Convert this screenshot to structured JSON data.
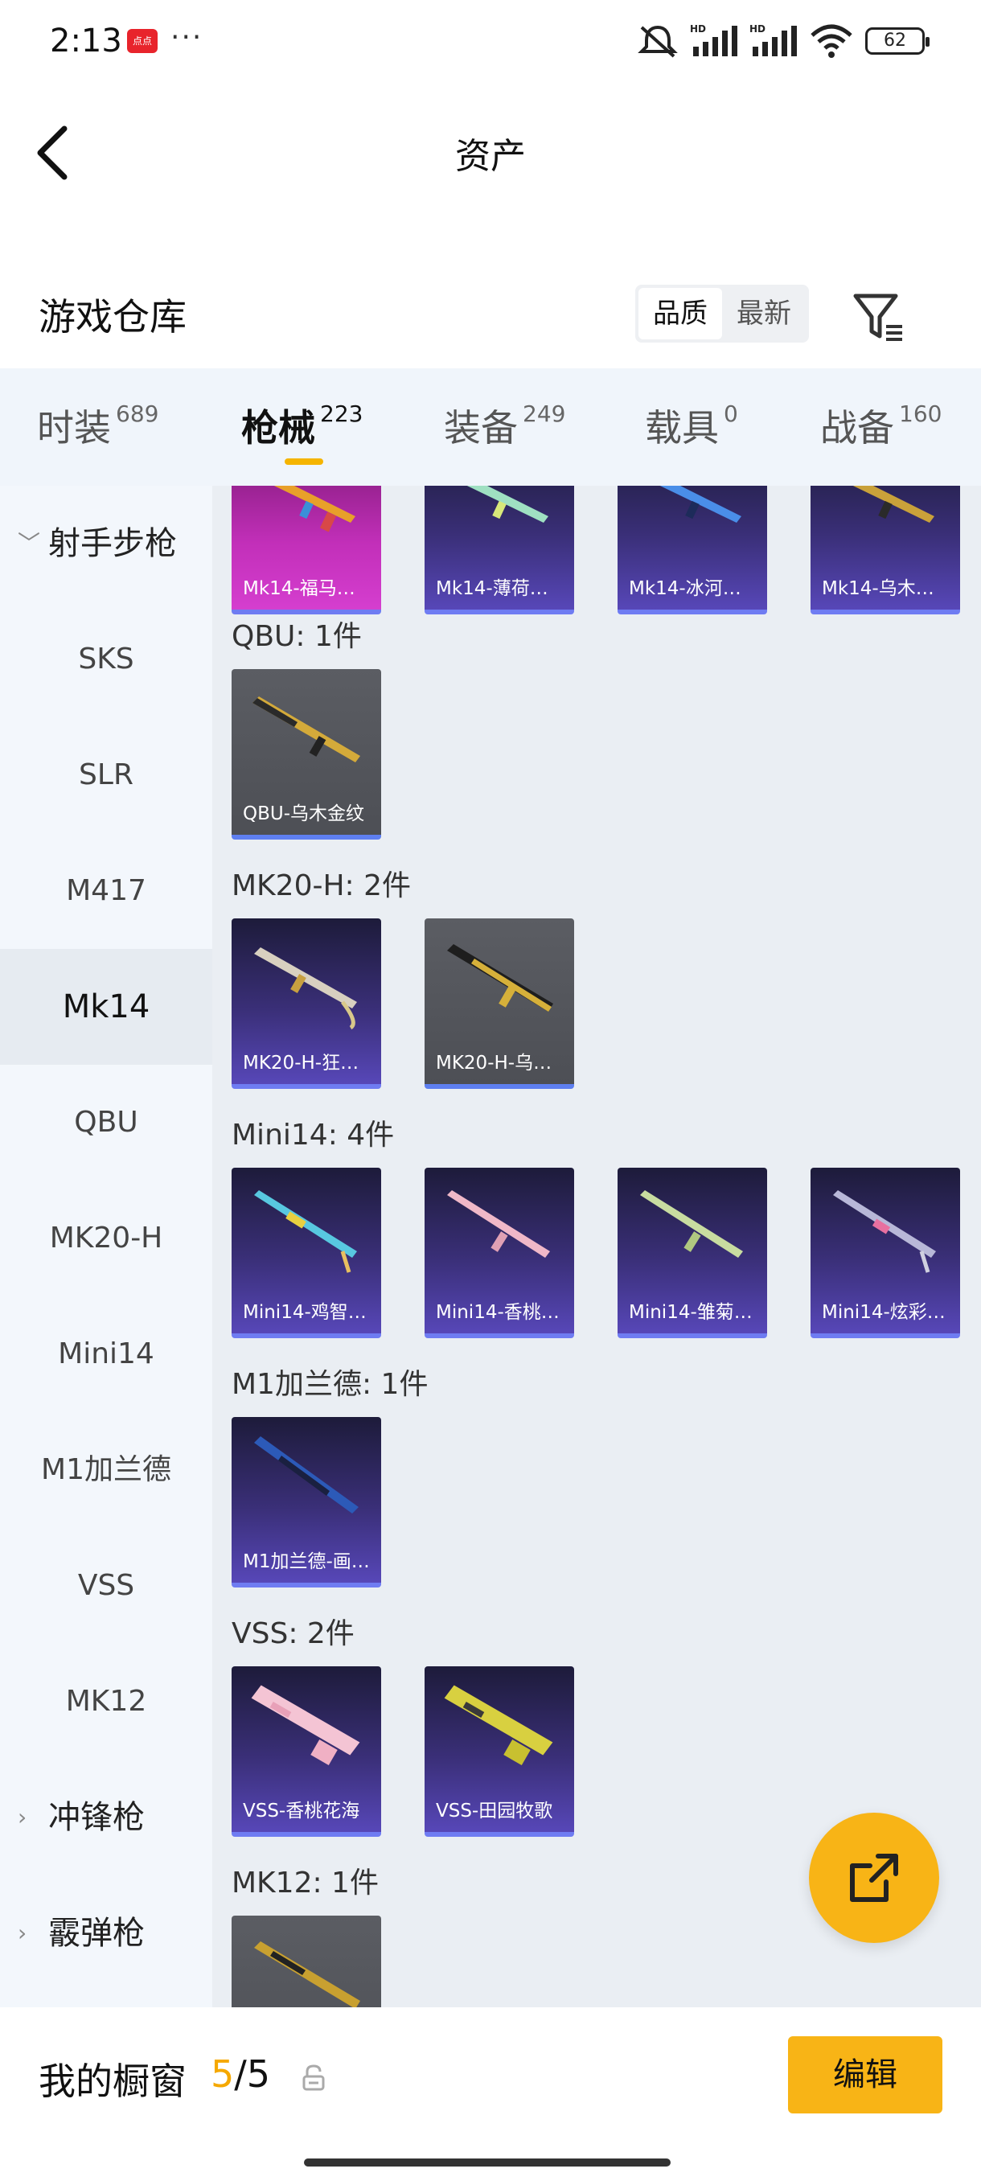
{
  "status": {
    "time": "2:13",
    "app_badge": "点点",
    "more": "···",
    "battery": "62"
  },
  "header": {
    "title": "资产"
  },
  "warehouse": {
    "title": "游戏仓库",
    "sort_options": [
      "品质",
      "最新"
    ],
    "sort_selected": "品质"
  },
  "tabs": [
    {
      "label": "时装",
      "count": "689"
    },
    {
      "label": "枪械",
      "count": "223"
    },
    {
      "label": "装备",
      "count": "249"
    },
    {
      "label": "载具",
      "count": "0"
    },
    {
      "label": "战备",
      "count": "160"
    }
  ],
  "sidebar": {
    "groups": [
      "射手步枪",
      "冲锋枪",
      "霰弹枪"
    ],
    "items": [
      "SKS",
      "SLR",
      "M417",
      "Mk14",
      "QBU",
      "MK20-H",
      "Mini14",
      "M1加兰德",
      "VSS",
      "MK12"
    ],
    "selected": "Mk14"
  },
  "content": {
    "top_cards": [
      "Mk14-福马…",
      "Mk14-薄荷…",
      "Mk14-冰河…",
      "Mk14-乌木…"
    ],
    "sections": [
      {
        "title": "QBU: 1件",
        "cards": [
          "QBU-乌木金纹"
        ]
      },
      {
        "title": "MK20-H: 2件",
        "cards": [
          "MK20-H-狂…",
          "MK20-H-乌…"
        ]
      },
      {
        "title": "Mini14: 4件",
        "cards": [
          "Mini14-鸡智…",
          "Mini14-香桃…",
          "Mini14-雏菊…",
          "Mini14-炫彩…"
        ]
      },
      {
        "title": "M1加兰德: 1件",
        "cards": [
          "M1加兰德-画…"
        ]
      },
      {
        "title": "VSS: 2件",
        "cards": [
          "VSS-香桃花海",
          "VSS-田园牧歌"
        ]
      },
      {
        "title": "MK12: 1件",
        "cards": []
      }
    ]
  },
  "bottom": {
    "shop_label": "我的橱窗",
    "shop_current": "5",
    "shop_sep": "/",
    "shop_total": "5",
    "edit_label": "编辑"
  },
  "colors": {
    "accent": "#f8b416",
    "card_purple": "#3a2f78",
    "card_gray": "#4d4f55",
    "card_pink": "#c22fb9"
  }
}
